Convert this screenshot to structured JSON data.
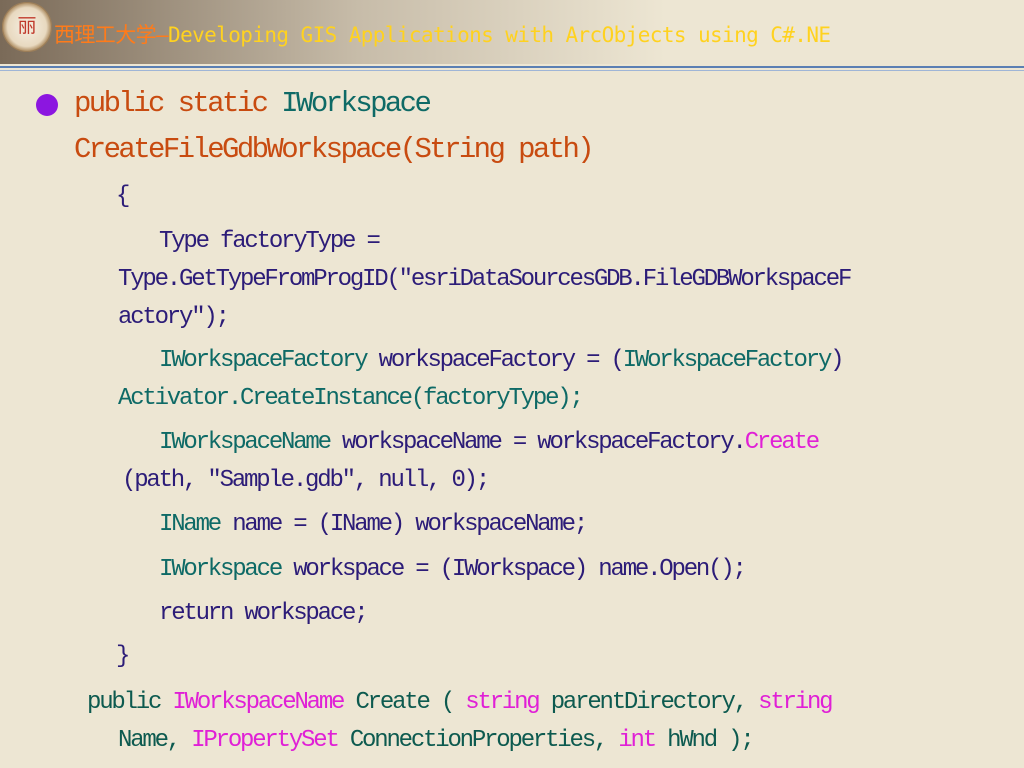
{
  "header": {
    "title_cn": "西理工大学",
    "title_sep": "–",
    "title_en": "Developing GIS Applications with ArcObjects using C#.NE"
  },
  "logo": {
    "icon": "university-seal-icon",
    "glyph": "丽"
  },
  "colors": {
    "background": "#ede6d3",
    "header_title": "#ffd21f",
    "header_cn": "#ff7b1a",
    "bullet": "#8c16e0",
    "keyword_orange": "#c84b10",
    "type_teal": "#0e6a66",
    "code_navy": "#2c1c78",
    "keyword_pink": "#e020d6"
  },
  "method": {
    "sig_kw": "public static ",
    "sig_type": "IWorkspace",
    "sig_name": "CreateFileGdbWorkspace(String path)",
    "open_brace": "{",
    "l1a": "Type factoryType =",
    "l1b": "Type.GetTypeFromProgID(\"esriDataSourcesGDB.FileGDBWorkspaceF",
    "l1c": "actory\");",
    "l2a_type": "IWorkspaceFactory",
    "l2a_rest": " workspaceFactory = (",
    "l2a_cast": "IWorkspaceFactory",
    "l2a_close": ")",
    "l2b": "Activator.CreateInstance(factoryType);",
    "l3a_type": "IWorkspaceName",
    "l3a_rest": " workspaceName = workspaceFactory.",
    "l3a_create": "Create",
    "l3b": "(path, \"Sample.gdb\", null, 0);",
    "l4_type": "IName",
    "l4_rest": " name = (IName) workspaceName;",
    "l5_type": "IWorkspace",
    "l5_rest": " workspace = (IWorkspace) name.Open();",
    "l6": "return workspace;",
    "close_brace": "}"
  },
  "signature": {
    "p1": "public ",
    "p2": "IWorkspaceName",
    "p3": " Create ( ",
    "p4": "string",
    "p5": " parentDirectory,  ",
    "p6": "string",
    "q1": "Name,   ",
    "q2": "IPropertySet",
    "q3": "  ConnectionProperties,  ",
    "q4": "int",
    "q5": " hWnd );"
  }
}
